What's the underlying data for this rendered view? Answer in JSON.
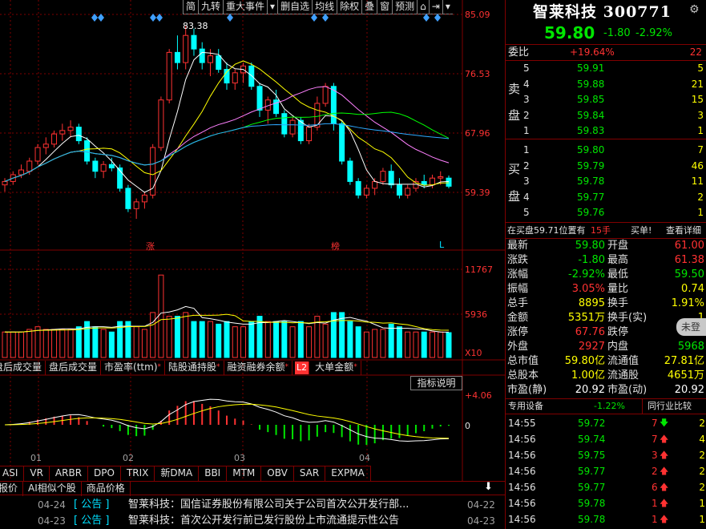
{
  "toolbar": {
    "items": [
      "简",
      "九转",
      "重大事件",
      "▾",
      "删自选",
      "均线",
      "除权",
      "叠",
      "窗",
      "预测",
      "⌂",
      "⇥",
      "▾"
    ]
  },
  "price_chart": {
    "high_marker": "83.38",
    "axis_labels": [
      "85.09",
      "76.53",
      "67.96",
      "59.39"
    ],
    "markers": [
      "涨",
      "榜",
      "L"
    ]
  },
  "volume_chart": {
    "axis_labels": [
      "11767",
      "5936"
    ],
    "unit": "X10"
  },
  "indicator_tabs": [
    {
      "label": "盘后成交量",
      "mark": ""
    },
    {
      "label": "盘后成交量",
      "mark": ""
    },
    {
      "label": "市盈率(ttm)",
      "mark": "*"
    },
    {
      "label": "陆股通持股",
      "mark": "*"
    },
    {
      "label": "融资融券余额",
      "mark": "*"
    },
    {
      "label": "L2",
      "mark": ""
    },
    {
      "label": "大单金额",
      "mark": "*"
    }
  ],
  "indicator_button": "指标说明",
  "macd_axis": [
    "+4.06",
    "0"
  ],
  "month_labels": [
    "01",
    "02",
    "03",
    "04"
  ],
  "bottom_tabs": [
    "ASI",
    "VR",
    "ARBR",
    "DPO",
    "TRIX",
    "新DMA",
    "BBI",
    "MTM",
    "OBV",
    "SAR",
    "EXPMA"
  ],
  "news_tabs": [
    "报价",
    "AI相似个股",
    "商品价格"
  ],
  "news": [
    {
      "date": "04-24",
      "type": "公告",
      "title": "智莱科技：国信证券股份有限公司关于公司首次公开发行部...",
      "right_date": "04-22"
    },
    {
      "date": "04-23",
      "type": "公告",
      "title": "智莱科技：首次公开发行前已发行股份上市流通提示性公告",
      "right_date": "04-23"
    }
  ],
  "stock": {
    "name": "智莱科技",
    "code": "300771",
    "price": "59.80",
    "change": "-1.80",
    "change_pct": "-2.92%"
  },
  "order_book": {
    "weibi_label": "委比",
    "weibi_value": "+19.64%",
    "weibi_diff": "22",
    "sell_label": [
      "卖",
      "盘"
    ],
    "buy_label": [
      "买",
      "盘"
    ],
    "sell": [
      {
        "level": "5",
        "price": "59.91",
        "vol": "5"
      },
      {
        "level": "4",
        "price": "59.88",
        "vol": "21"
      },
      {
        "level": "3",
        "price": "59.85",
        "vol": "15"
      },
      {
        "level": "2",
        "price": "59.84",
        "vol": "3"
      },
      {
        "level": "1",
        "price": "59.83",
        "vol": "1"
      }
    ],
    "buy": [
      {
        "level": "1",
        "price": "59.80",
        "vol": "7"
      },
      {
        "level": "2",
        "price": "59.79",
        "vol": "46"
      },
      {
        "level": "3",
        "price": "59.78",
        "vol": "11"
      },
      {
        "level": "4",
        "price": "59.77",
        "vol": "2"
      },
      {
        "level": "5",
        "price": "59.76",
        "vol": "1"
      }
    ],
    "notice": "在买盘59.71位置有",
    "notice_vol": "15手",
    "notice_action": "买单!",
    "notice_link": "查看详细"
  },
  "stats": [
    {
      "l": "最新",
      "lv": "59.80",
      "r": "开盘",
      "rv": "61.00"
    },
    {
      "l": "涨跌",
      "lv": "-1.80",
      "r": "最高",
      "rv": "61.38"
    },
    {
      "l": "涨幅",
      "lv": "-2.92%",
      "r": "最低",
      "rv": "59.50"
    },
    {
      "l": "振幅",
      "lv": "3.05%",
      "r": "量比",
      "rv": "0.74"
    },
    {
      "l": "总手",
      "lv": "8895",
      "r": "换手",
      "rv": "1.91%"
    },
    {
      "l": "金额",
      "lv": "5351万",
      "r": "换手(实)",
      "rv": "1"
    },
    {
      "l": "涨停",
      "lv": "67.76",
      "r": "跌停",
      "rv": ""
    },
    {
      "l": "外盘",
      "lv": "2927",
      "r": "内盘",
      "rv": "5968"
    },
    {
      "l": "总市值",
      "lv": "59.80亿",
      "r": "流通值",
      "rv": "27.81亿"
    },
    {
      "l": "总股本",
      "lv": "1.00亿",
      "r": "流通股",
      "rv": "4651万"
    },
    {
      "l": "市盈(静)",
      "lv": "20.92",
      "r": "市盈(动)",
      "rv": "20.92"
    }
  ],
  "login_badge": "未登",
  "sector": {
    "name": "专用设备",
    "pct": "-1.22%",
    "link": "同行业比较"
  },
  "ticks": [
    {
      "t": "14:55",
      "p": "59.72",
      "v": "7",
      "dir": "down",
      "n": "2"
    },
    {
      "t": "14:56",
      "p": "59.74",
      "v": "7",
      "dir": "up",
      "n": "4"
    },
    {
      "t": "14:56",
      "p": "59.75",
      "v": "3",
      "dir": "up",
      "n": "2"
    },
    {
      "t": "14:56",
      "p": "59.77",
      "v": "2",
      "dir": "up",
      "n": "2"
    },
    {
      "t": "14:56",
      "p": "59.77",
      "v": "6",
      "dir": "up",
      "n": "2"
    },
    {
      "t": "14:56",
      "p": "59.78",
      "v": "1",
      "dir": "up",
      "n": "1"
    },
    {
      "t": "14:56",
      "p": "59.78",
      "v": "1",
      "dir": "up",
      "n": "1"
    }
  ],
  "chart_data": {
    "type": "candlestick",
    "price_range": [
      53,
      85.09
    ],
    "candles": [
      [
        60,
        61,
        59,
        60.5
      ],
      [
        60.5,
        62,
        60,
        61.5
      ],
      [
        61.5,
        63,
        61,
        62.2
      ],
      [
        62,
        64,
        61.5,
        63.5
      ],
      [
        63.5,
        66,
        63,
        65.5
      ],
      [
        65.5,
        67,
        64.5,
        66
      ],
      [
        66,
        68,
        65.5,
        67.5
      ],
      [
        67.5,
        69,
        66.5,
        68
      ],
      [
        68,
        69.5,
        67,
        68.5
      ],
      [
        68.5,
        69,
        66,
        66.5
      ],
      [
        66.5,
        67,
        63,
        63.5
      ],
      [
        63.5,
        64,
        61,
        62
      ],
      [
        62,
        63.5,
        61,
        63
      ],
      [
        63,
        64,
        62,
        62.5
      ],
      [
        62.5,
        63,
        59,
        59.5
      ],
      [
        59.5,
        60,
        56,
        56.5
      ],
      [
        56.5,
        58,
        55,
        57.5
      ],
      [
        57.5,
        59,
        56.5,
        58.5
      ],
      [
        58.5,
        66,
        58,
        65.5
      ],
      [
        65.5,
        73,
        65,
        72.5
      ],
      [
        72.5,
        80,
        72,
        79.5
      ],
      [
        79.5,
        82,
        77,
        78
      ],
      [
        78,
        83.38,
        77,
        82
      ],
      [
        82,
        83,
        79,
        80
      ],
      [
        80,
        81,
        77,
        78
      ],
      [
        78,
        80,
        76,
        79
      ],
      [
        79,
        80,
        76.5,
        77
      ],
      [
        77,
        78,
        74,
        75
      ],
      [
        75,
        77,
        74,
        76.5
      ],
      [
        76.5,
        78,
        75,
        77.5
      ],
      [
        77.5,
        78,
        74,
        74.5
      ],
      [
        74.5,
        75,
        70,
        71
      ],
      [
        71,
        73,
        69,
        72.5
      ],
      [
        72.5,
        74,
        70,
        70.5
      ],
      [
        70.5,
        71,
        67,
        67.5
      ],
      [
        67.5,
        70,
        67,
        69.5
      ],
      [
        69.5,
        70,
        66,
        66.5
      ],
      [
        66.5,
        69,
        66,
        68.5
      ],
      [
        68.5,
        73,
        68,
        72
      ],
      [
        72,
        75,
        71.5,
        74.5
      ],
      [
        74.5,
        75,
        68,
        69
      ],
      [
        69,
        69.5,
        63,
        63.5
      ],
      [
        63.5,
        64,
        60,
        60.5
      ],
      [
        60.5,
        61,
        58,
        58.5
      ],
      [
        58.5,
        60,
        58,
        59.5
      ],
      [
        59.5,
        61,
        58.5,
        60.5
      ],
      [
        60.5,
        62.5,
        60,
        62
      ],
      [
        62,
        63,
        59.5,
        60
      ],
      [
        60,
        61,
        58,
        58.5
      ],
      [
        58.5,
        60,
        58,
        59.5
      ],
      [
        59.5,
        61,
        59,
        60.5
      ],
      [
        60.5,
        61.5,
        59.5,
        60
      ],
      [
        60,
        61.5,
        59.5,
        61
      ],
      [
        61,
        62,
        60,
        61.2
      ],
      [
        61,
        61.38,
        59.5,
        59.8
      ]
    ]
  }
}
